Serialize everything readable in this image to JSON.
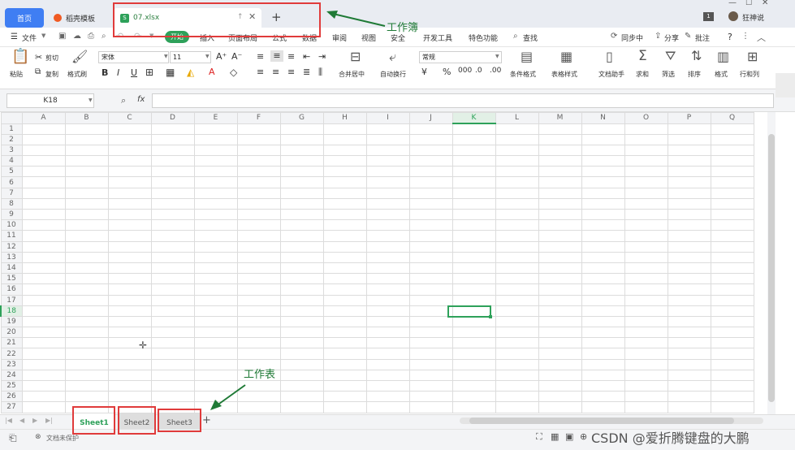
{
  "titlebar": {
    "home_tab": "首页",
    "template_tab": "稻壳模板",
    "file_tab": "07.xlsx",
    "file_icon": "S",
    "new_tab": "+",
    "badge": "1",
    "user": "狂神说"
  },
  "menu": {
    "file": "文件",
    "items": [
      "开始",
      "插入",
      "页面布局",
      "公式",
      "数据",
      "审阅",
      "视图",
      "安全",
      "开发工具",
      "特色功能"
    ],
    "search": "查找",
    "sync": "同步中",
    "share": "分享",
    "comment": "批注",
    "help": "?"
  },
  "ribbon": {
    "paste": "粘贴",
    "cut": "剪切",
    "copy": "复制",
    "format_painter": "格式刷",
    "font_name": "宋体",
    "font_size": "11",
    "merge_center": "合并居中",
    "wrap_text": "自动换行",
    "number_format": "常规",
    "conditional_format": "条件格式",
    "table_style": "表格样式",
    "doc_assistant": "文档助手",
    "sum": "求和",
    "filter": "筛选",
    "sort": "排序",
    "format": "格式",
    "rows_cols": "行和列"
  },
  "formula": {
    "cell_ref": "K18",
    "fx": "fx"
  },
  "grid": {
    "columns": [
      "A",
      "B",
      "C",
      "D",
      "E",
      "F",
      "G",
      "H",
      "I",
      "J",
      "K",
      "L",
      "M",
      "N",
      "O",
      "P",
      "Q"
    ],
    "rows": [
      "1",
      "2",
      "3",
      "4",
      "5",
      "6",
      "7",
      "8",
      "9",
      "10",
      "11",
      "12",
      "13",
      "14",
      "15",
      "16",
      "17",
      "18",
      "19",
      "20",
      "21",
      "22",
      "23",
      "24",
      "25",
      "26",
      "27"
    ],
    "active_col": "K",
    "active_row": "18"
  },
  "sheets": [
    "Sheet1",
    "Sheet2",
    "Sheet3"
  ],
  "sheet_add": "+",
  "status": {
    "protect": "文档未保护",
    "watermark": "CSDN @爱折腾键盘的大鹏"
  },
  "annotations": {
    "workbook": "工作簿",
    "worksheet": "工作表"
  },
  "colors": {
    "accent_green": "#2ea15a",
    "annotation_red": "#e03b3b",
    "home_blue": "#3f7ef3"
  }
}
